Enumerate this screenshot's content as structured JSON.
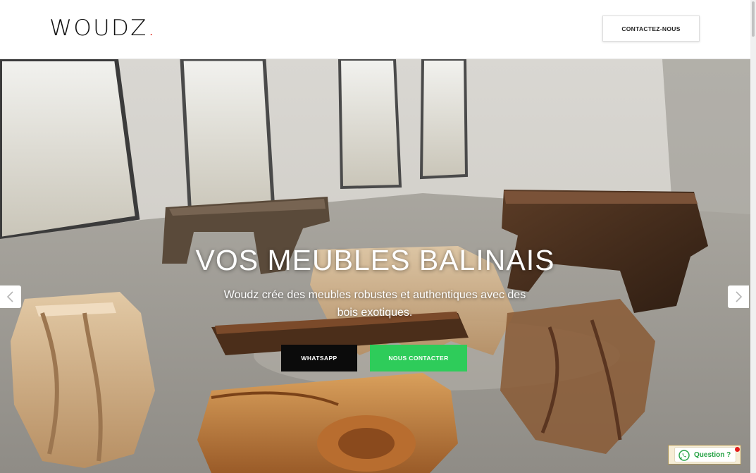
{
  "header": {
    "logo_text": "WOUDZ",
    "logo_dot": ".",
    "contact_button": "CONTACTEZ-NOUS"
  },
  "hero": {
    "title": "VOS MEUBLES BALINAIS",
    "subtitle": "Woudz crée des meubles robustes et authentiques avec des bois exotiques.",
    "buttons": {
      "whatsapp": "WHATSAPP",
      "contact": "NOUS CONTACTER"
    },
    "prev_icon": "chevron-left-icon",
    "next_icon": "chevron-right-icon"
  },
  "widget": {
    "label": "Question ?",
    "icon": "whatsapp-icon"
  },
  "colors": {
    "accent_red": "#e0352b",
    "green": "#2ecc5a",
    "black": "#0b0b0b"
  }
}
